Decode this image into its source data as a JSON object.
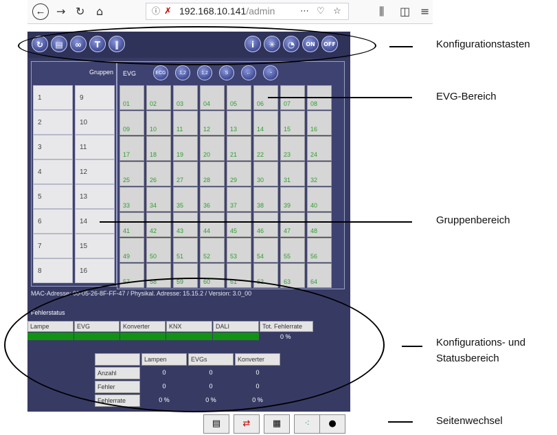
{
  "browser": {
    "back_icon": "arrow-left-icon",
    "url_host": "192.168.10.141",
    "url_path": "/admin"
  },
  "groups": {
    "header": "Gruppen",
    "items": [
      "1",
      "9",
      "2",
      "10",
      "3",
      "11",
      "4",
      "12",
      "5",
      "13",
      "6",
      "14",
      "7",
      "15",
      "8",
      "16"
    ]
  },
  "evg": {
    "header": "EVG",
    "buttons": [
      "ECG ×",
      "1,2.. ×",
      "1,2.. ✓",
      "S ✓",
      "",
      "ⓘ"
    ],
    "cells": [
      "01",
      "02",
      "03",
      "04",
      "05",
      "06",
      "07",
      "08",
      "09",
      "10",
      "11",
      "12",
      "13",
      "14",
      "15",
      "16",
      "17",
      "18",
      "19",
      "20",
      "21",
      "22",
      "23",
      "24",
      "25",
      "26",
      "27",
      "28",
      "29",
      "30",
      "31",
      "32",
      "33",
      "34",
      "35",
      "36",
      "37",
      "38",
      "39",
      "40",
      "41",
      "42",
      "43",
      "44",
      "45",
      "46",
      "47",
      "48",
      "49",
      "50",
      "51",
      "52",
      "53",
      "54",
      "55",
      "56",
      "57",
      "58",
      "59",
      "60",
      "61",
      "62",
      "63",
      "64"
    ]
  },
  "toolbar": {
    "on_label": "ON",
    "off_label": "OFF"
  },
  "mac": "MAC-Adresse: 00-05-26-8F-FF-47 / Physikal. Adresse: 15.15.2 / Version: 3.0_00",
  "fehlerstatus": {
    "title": "Fehlerstatus",
    "columns": [
      "Lampe",
      "EVG",
      "Konverter",
      "KNX",
      "DALI",
      "Tot. Fehlerrate"
    ],
    "total_rate": "0 %"
  },
  "stats": {
    "columns": [
      "Lampen",
      "EVGs",
      "Konverter"
    ],
    "rows": [
      {
        "label": "Anzahl",
        "values": [
          "0",
          "0",
          "0"
        ]
      },
      {
        "label": "Fehler",
        "values": [
          "0",
          "0",
          "0"
        ]
      },
      {
        "label": "Fehlerrate",
        "values": [
          "0 %",
          "0 %",
          "0 %"
        ]
      }
    ]
  },
  "callouts": {
    "konfigurationstasten": "Konfigurationstasten",
    "evg_bereich": "EVG-Bereich",
    "gruppenbereich": "Gruppenbereich",
    "konfig_status_1": "Konfigurations- und",
    "konfig_status_2": "Statusbereich",
    "seitenwechsel": "Seitenwechsel"
  },
  "colors": {
    "panel": "#373b64",
    "ok_green": "#129212",
    "cell_text": "#2f9d2f"
  }
}
